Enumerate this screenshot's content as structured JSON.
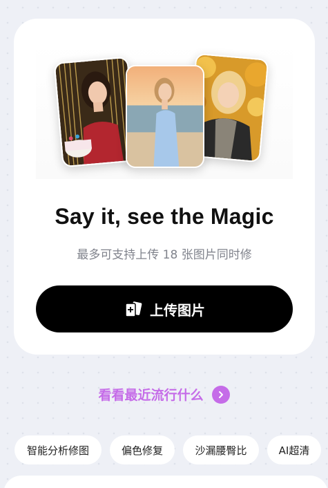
{
  "card": {
    "title": "Say it, see the Magic",
    "subtitle": "最多可支持上传 18 张图片同时修",
    "upload_button": {
      "label": "上传图片",
      "icon": "add-photo-icon"
    }
  },
  "trending": {
    "label": "看看最近流行什么",
    "icon": "chevron-right-icon",
    "accent": "#c56ce8"
  },
  "chips": [
    "智能分析修图",
    "偏色修复",
    "沙漏腰臀比",
    "AI超清"
  ],
  "colors": {
    "background": "#eef0f6",
    "button": "#000000",
    "accent": "#c56ce8"
  }
}
